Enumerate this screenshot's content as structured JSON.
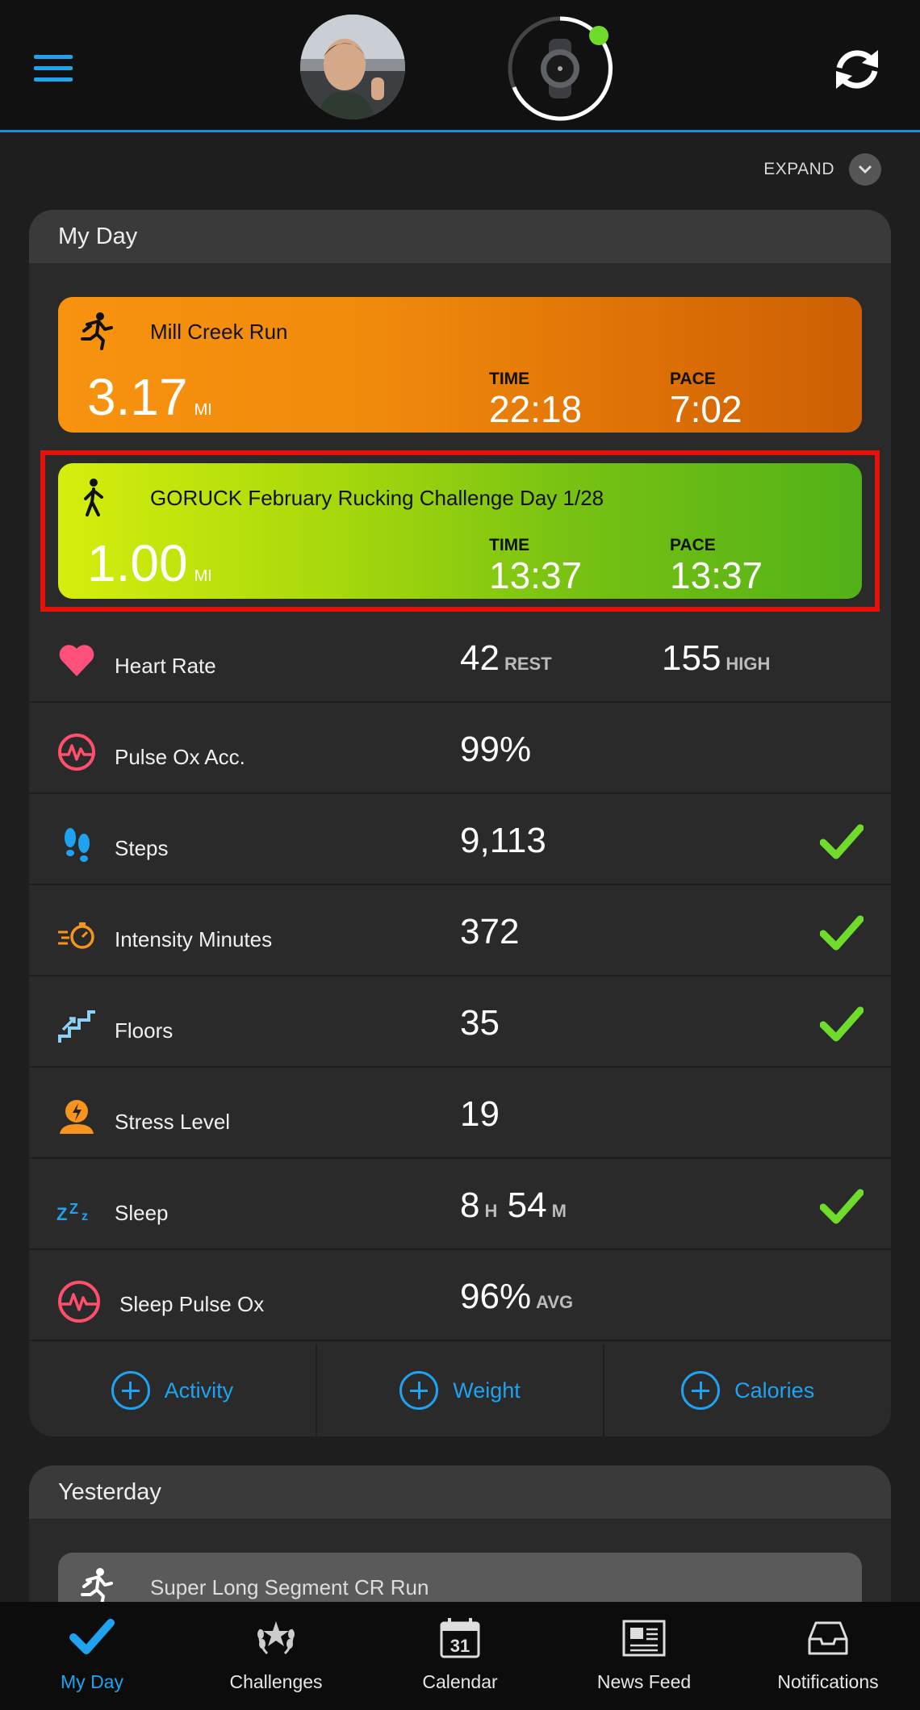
{
  "header": {
    "expand_label": "EXPAND"
  },
  "my_day": {
    "title": "My Day",
    "activities": [
      {
        "name": "Mill Creek Run",
        "distance": "3.17",
        "unit": "MI",
        "time_label": "TIME",
        "time": "22:18",
        "pace_label": "PACE",
        "pace": "7:02",
        "color": "#f08a0c"
      },
      {
        "name": "GORUCK February Rucking Challenge Day 1/28",
        "distance": "1.00",
        "unit": "MI",
        "time_label": "TIME",
        "time": "13:37",
        "pace_label": "PACE",
        "pace": "13:37",
        "color": "#8ccb10",
        "highlighted": true
      }
    ],
    "metrics": [
      {
        "label": "Heart Rate",
        "value": "42",
        "unit": "REST",
        "value2": "155",
        "unit2": "HIGH",
        "icon": "heart-icon"
      },
      {
        "label": "Pulse Ox Acc.",
        "value": "99%",
        "icon": "pulse-ox-icon"
      },
      {
        "label": "Steps",
        "value": "9,113",
        "icon": "footprints-icon",
        "goal_met": true
      },
      {
        "label": "Intensity Minutes",
        "value": "372",
        "icon": "stopwatch-icon",
        "goal_met": true
      },
      {
        "label": "Floors",
        "value": "35",
        "icon": "stairs-icon",
        "goal_met": true
      },
      {
        "label": "Stress Level",
        "value": "19",
        "icon": "stress-icon"
      },
      {
        "label": "Sleep",
        "value": "8",
        "unit": "H",
        "value_b": "54",
        "unit_b": "M",
        "icon": "sleep-icon",
        "goal_met": true
      },
      {
        "label": "Sleep Pulse Ox",
        "value": "96%",
        "unit": "AVG",
        "icon": "sleep-pulse-ox-icon"
      }
    ],
    "add_buttons": [
      "Activity",
      "Weight",
      "Calories"
    ]
  },
  "yesterday": {
    "title": "Yesterday",
    "activity_name": "Super Long Segment CR Run"
  },
  "nav": {
    "items": [
      "My Day",
      "Challenges",
      "Calendar",
      "News Feed",
      "Notifications"
    ],
    "calendar_day": "31",
    "active": "My Day"
  },
  "colors": {
    "accent": "#1fa3f0",
    "check": "#6fdc2b",
    "highlight_border": "#e3120b",
    "heart": "#ff4f7b",
    "pulse": "#ff4f6b"
  }
}
